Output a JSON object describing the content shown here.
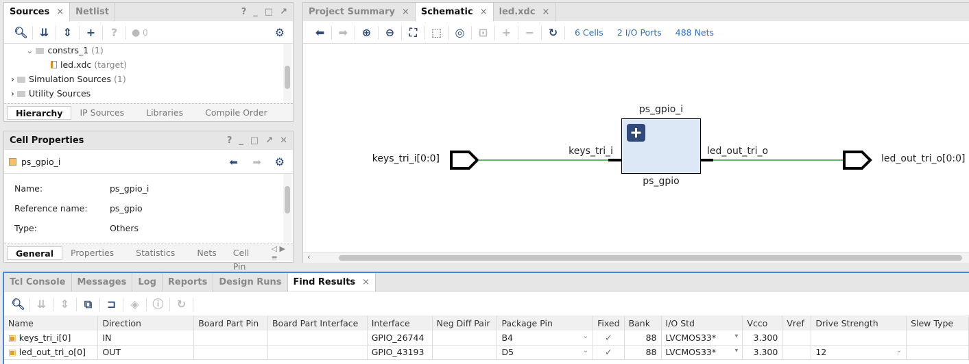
{
  "sources_panel": {
    "tabs": [
      {
        "label": "Sources",
        "active": true
      },
      {
        "label": "Netlist",
        "active": false
      }
    ],
    "window_buttons": [
      "?",
      "_",
      "□",
      "↗"
    ],
    "toolbar": {
      "icons": [
        "search-icon",
        "collapse-all-icon",
        "expand-all-icon",
        "add-icon",
        "question-icon",
        "error-indicator-icon",
        "gear-icon"
      ],
      "error_count": "0"
    },
    "tree": [
      {
        "label": "constrs_1",
        "count": "(1)",
        "expanded": true,
        "level": 1
      },
      {
        "label": "led.xdc",
        "count": "(target)",
        "level": 2,
        "icon": "xdc-file-icon"
      },
      {
        "label": "Simulation Sources",
        "count": "(1)",
        "expanded": false,
        "level": 0
      },
      {
        "label": "Utility Sources",
        "count": "",
        "expanded": false,
        "level": 0
      }
    ],
    "bottom_tabs": [
      "Hierarchy",
      "IP Sources",
      "Libraries",
      "Compile Order"
    ]
  },
  "cell_properties": {
    "title": "Cell Properties",
    "cell_name": "ps_gpio_i",
    "properties": [
      {
        "label": "Name:",
        "value": "ps_gpio_i"
      },
      {
        "label": "Reference name:",
        "value": "ps_gpio"
      },
      {
        "label": "Type:",
        "value": "Others"
      }
    ],
    "bottom_tabs": [
      "General",
      "Properties",
      "Statistics",
      "Nets",
      "Cell Pin"
    ]
  },
  "editor": {
    "tabs": [
      {
        "label": "Project Summary",
        "active": false
      },
      {
        "label": "Schematic",
        "active": true
      },
      {
        "label": "led.xdc",
        "active": false
      }
    ],
    "toolbar": {
      "links": [
        "6 Cells",
        "2 I/O Ports",
        "488 Nets"
      ]
    },
    "schematic": {
      "input_port": "keys_tri_i[0:0]",
      "output_port": "led_out_tri_o[0:0]",
      "cell_instance": "ps_gpio_i",
      "cell_reference": "ps_gpio",
      "input_pin": "keys_tri_i",
      "output_pin": "led_out_tri_o",
      "net_color": "#2ca02c",
      "cell_fill": "#dde8f6"
    }
  },
  "bottom_panel": {
    "tabs": [
      {
        "label": "Tcl Console"
      },
      {
        "label": "Messages"
      },
      {
        "label": "Log"
      },
      {
        "label": "Reports"
      },
      {
        "label": "Design Runs"
      },
      {
        "label": "Find Results",
        "active": true
      }
    ],
    "accent": "#4a86d8",
    "columns": [
      "Name",
      "Direction",
      "Board Part Pin",
      "Board Part Interface",
      "Interface",
      "Neg Diff Pair",
      "Package Pin",
      "Fixed",
      "Bank",
      "I/O Std",
      "Vcco",
      "Vref",
      "Drive Strength",
      "Slew Type"
    ],
    "rows": [
      {
        "name": "keys_tri_i[0]",
        "direction": "IN",
        "board_part_pin": "",
        "board_part_interface": "",
        "interface": "GPIO_26744",
        "neg_diff_pair": "",
        "package_pin": "B4",
        "fixed": "✓",
        "bank": "88",
        "io_std": "LVCMOS33*",
        "vcco": "3.300",
        "vref": "",
        "drive_strength": "",
        "slew_type": ""
      },
      {
        "name": "led_out_tri_o[0]",
        "direction": "OUT",
        "board_part_pin": "",
        "board_part_interface": "",
        "interface": "GPIO_43193",
        "neg_diff_pair": "",
        "package_pin": "D5",
        "fixed": "✓",
        "bank": "88",
        "io_std": "LVCMOS33*",
        "vcco": "3.300",
        "vref": "",
        "drive_strength": "12",
        "slew_type": ""
      }
    ]
  }
}
